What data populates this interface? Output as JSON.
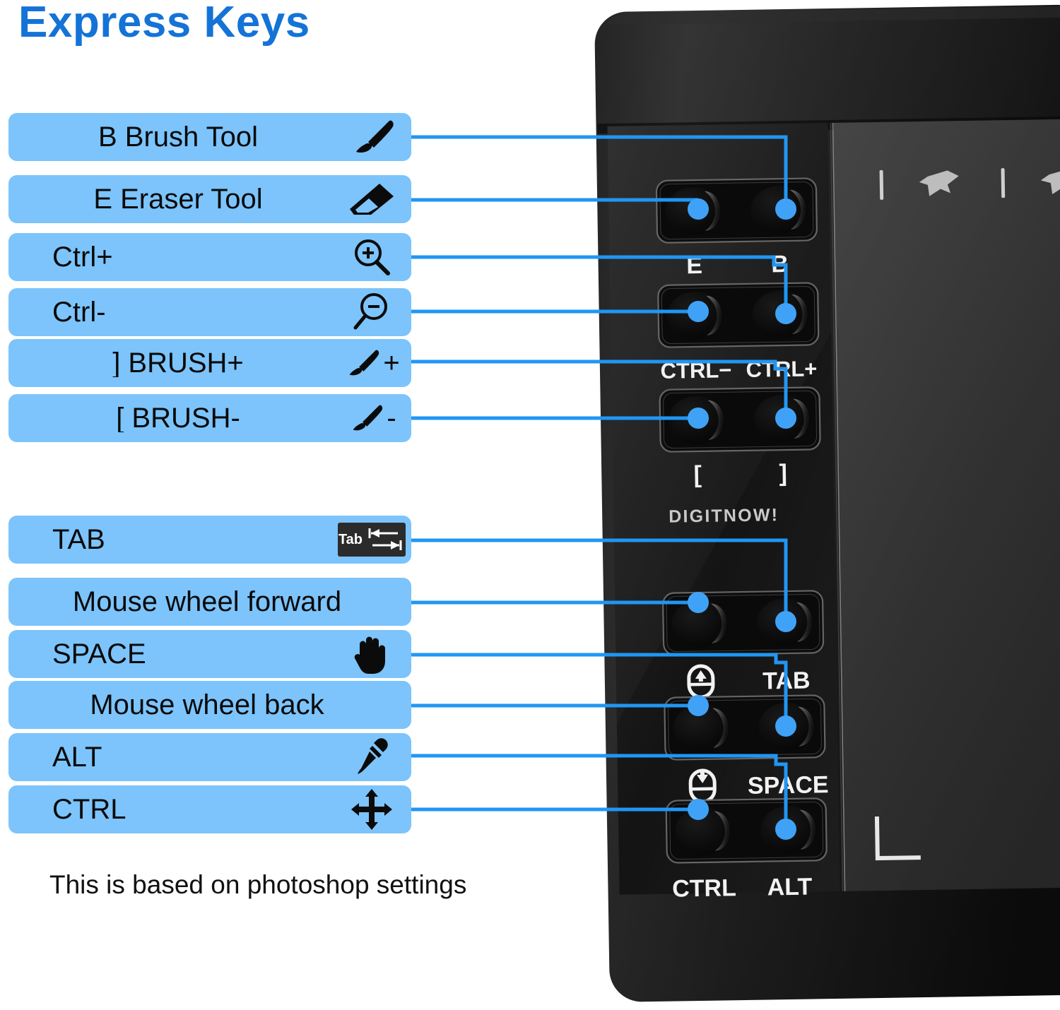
{
  "title": "Express Keys",
  "footnote": "This is based on photoshop settings",
  "colors": {
    "pill_blue": "#7CC4FB",
    "title_blue": "#1473D6",
    "wire_blue": "#2196F3",
    "dot_blue": "#3FA2F7",
    "text_black": "#0A0A0A",
    "device_black": "#1C1C1C"
  },
  "groups": [
    {
      "name": "upper",
      "labels": [
        {
          "text": "B Brush Tool",
          "icon": "brush-icon",
          "suffix": "",
          "align": "center"
        },
        {
          "text": "E Eraser Tool",
          "icon": "eraser-icon",
          "suffix": "",
          "align": "center"
        },
        {
          "text": "Ctrl+",
          "icon": "zoom-in-icon",
          "suffix": "",
          "align": "left"
        },
        {
          "text": "Ctrl-",
          "icon": "zoom-out-icon",
          "suffix": "",
          "align": "left"
        },
        {
          "text": "]  BRUSH+",
          "icon": "brush-icon",
          "suffix": "+",
          "align": "center"
        },
        {
          "text": "[  BRUSH-",
          "icon": "brush-icon",
          "suffix": "-",
          "align": "center"
        }
      ]
    },
    {
      "name": "lower",
      "labels": [
        {
          "text": "TAB",
          "icon": "tab-key-icon",
          "suffix": "",
          "align": "left"
        },
        {
          "text": "Mouse wheel forward",
          "icon": "none",
          "suffix": "",
          "align": "center"
        },
        {
          "text": "SPACE",
          "icon": "hand-icon",
          "suffix": "",
          "align": "left"
        },
        {
          "text": "Mouse wheel back",
          "icon": "none",
          "suffix": "",
          "align": "center"
        },
        {
          "text": "ALT",
          "icon": "eyedropper-icon",
          "suffix": "",
          "align": "left"
        },
        {
          "text": "CTRL",
          "icon": "move-icon",
          "suffix": "",
          "align": "left"
        }
      ]
    }
  ],
  "tab_key_glyph": {
    "label": "Tab"
  },
  "device": {
    "brand": "DIGITNOW!",
    "button_rows": [
      {
        "left_key": "E",
        "right_key": "B"
      },
      {
        "left_key": "CTRL-",
        "right_key": "CTRL+"
      },
      {
        "left_key": "[",
        "right_key": "]"
      },
      {
        "left_key": "scroll-up-icon",
        "right_key": "TAB"
      },
      {
        "left_key": "scroll-down-icon",
        "right_key": "SPACE"
      },
      {
        "left_key": "CTRL",
        "right_key": "ALT"
      }
    ],
    "key_labels_row1": {
      "left": "E",
      "right": "B"
    },
    "key_labels_row2": {
      "left": "CTRL-",
      "right": "CTRL+"
    },
    "key_labels_row3": {
      "left": "[",
      "right": "]"
    },
    "key_labels_row4": {
      "left": "",
      "right": "TAB"
    },
    "key_labels_row5": {
      "left": "",
      "right": "SPACE"
    },
    "key_labels_row6": {
      "left": "CTRL",
      "right": "ALT"
    }
  }
}
